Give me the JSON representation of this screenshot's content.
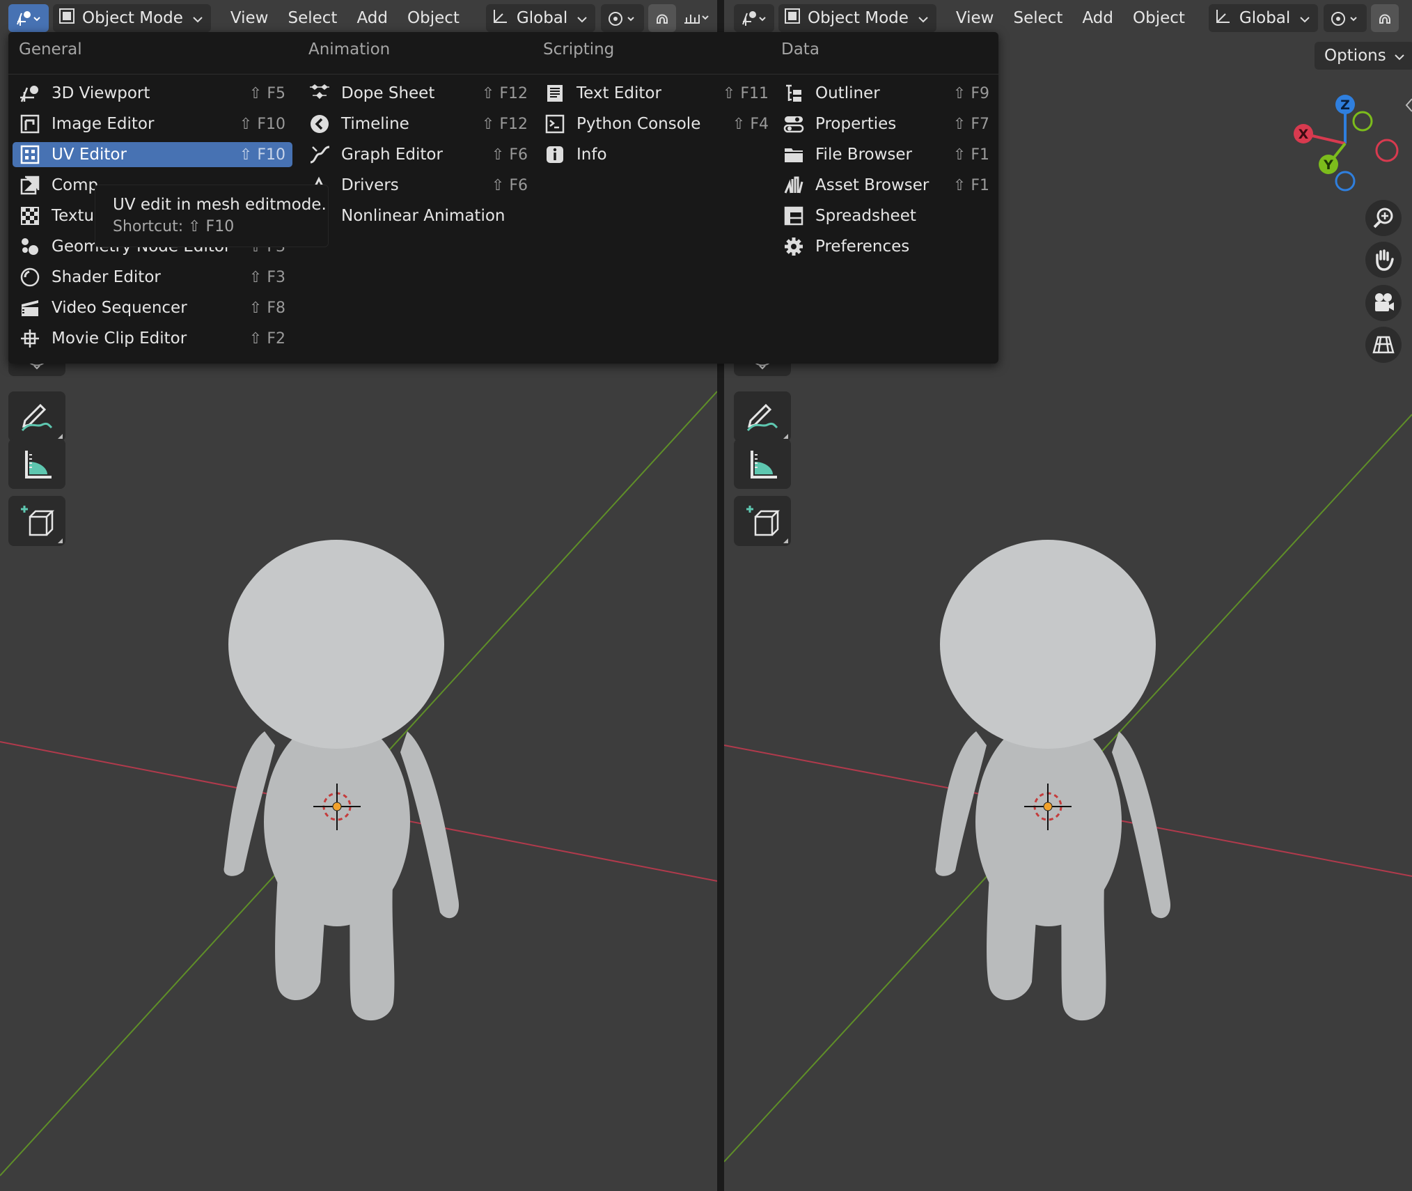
{
  "header": {
    "mode_label": "Object Mode",
    "menu": [
      "View",
      "Select",
      "Add",
      "Object"
    ],
    "orientation_label": "Global"
  },
  "options_label": "Options",
  "gizmo": {
    "x": "X",
    "y": "Y",
    "z": "Z"
  },
  "editor_menu": {
    "categories": [
      "General",
      "Animation",
      "Scripting",
      "Data"
    ],
    "general": [
      {
        "label": "3D Viewport",
        "shortcut": "⇧ F5",
        "icon": "3d-viewport-icon"
      },
      {
        "label": "Image Editor",
        "shortcut": "⇧ F10",
        "icon": "image-editor-icon"
      },
      {
        "label": "UV Editor",
        "shortcut": "⇧ F10",
        "icon": "uv-editor-icon"
      },
      {
        "label": "Comp",
        "shortcut": "",
        "icon": "compositor-icon"
      },
      {
        "label": "Textu",
        "shortcut": "",
        "icon": "texture-icon"
      },
      {
        "label": "Geometry Node Editor",
        "shortcut": "⇧ F3",
        "icon": "geometry-nodes-icon"
      },
      {
        "label": "Shader Editor",
        "shortcut": "⇧ F3",
        "icon": "shader-icon"
      },
      {
        "label": "Video Sequencer",
        "shortcut": "⇧ F8",
        "icon": "sequencer-icon"
      },
      {
        "label": "Movie Clip Editor",
        "shortcut": "⇧ F2",
        "icon": "movie-clip-icon"
      }
    ],
    "animation": [
      {
        "label": "Dope Sheet",
        "shortcut": "⇧ F12",
        "icon": "dope-sheet-icon"
      },
      {
        "label": "Timeline",
        "shortcut": "⇧ F12",
        "icon": "timeline-icon"
      },
      {
        "label": "Graph Editor",
        "shortcut": "⇧ F6",
        "icon": "graph-editor-icon"
      },
      {
        "label": "Drivers",
        "shortcut": "⇧ F6",
        "icon": "drivers-icon"
      },
      {
        "label": "Nonlinear Animation",
        "shortcut": "",
        "icon": "nla-icon"
      }
    ],
    "scripting": [
      {
        "label": "Text Editor",
        "shortcut": "⇧ F11",
        "icon": "text-editor-icon"
      },
      {
        "label": "Python Console",
        "shortcut": "⇧ F4",
        "icon": "console-icon"
      },
      {
        "label": "Info",
        "shortcut": "",
        "icon": "info-icon"
      }
    ],
    "data": [
      {
        "label": "Outliner",
        "shortcut": "⇧ F9",
        "icon": "outliner-icon"
      },
      {
        "label": "Properties",
        "shortcut": "⇧ F7",
        "icon": "properties-icon"
      },
      {
        "label": "File Browser",
        "shortcut": "⇧ F1",
        "icon": "file-browser-icon"
      },
      {
        "label": "Asset Browser",
        "shortcut": "⇧ F1",
        "icon": "asset-browser-icon"
      },
      {
        "label": "Spreadsheet",
        "shortcut": "",
        "icon": "spreadsheet-icon"
      },
      {
        "label": "Preferences",
        "shortcut": "",
        "icon": "preferences-icon"
      }
    ]
  },
  "tooltip": {
    "description": "UV edit in mesh editmode.",
    "shortcut": "Shortcut: ⇧ F10"
  },
  "colors": {
    "menu_highlight": "#4772b3",
    "viewport_bg": "#3d3d3d",
    "axis_x": "#c0394f",
    "axis_y": "#6a9a2c",
    "gizmo_z": "#2f7fde",
    "gizmo_y": "#7cbc1c",
    "gizmo_x": "#d83a4f"
  }
}
